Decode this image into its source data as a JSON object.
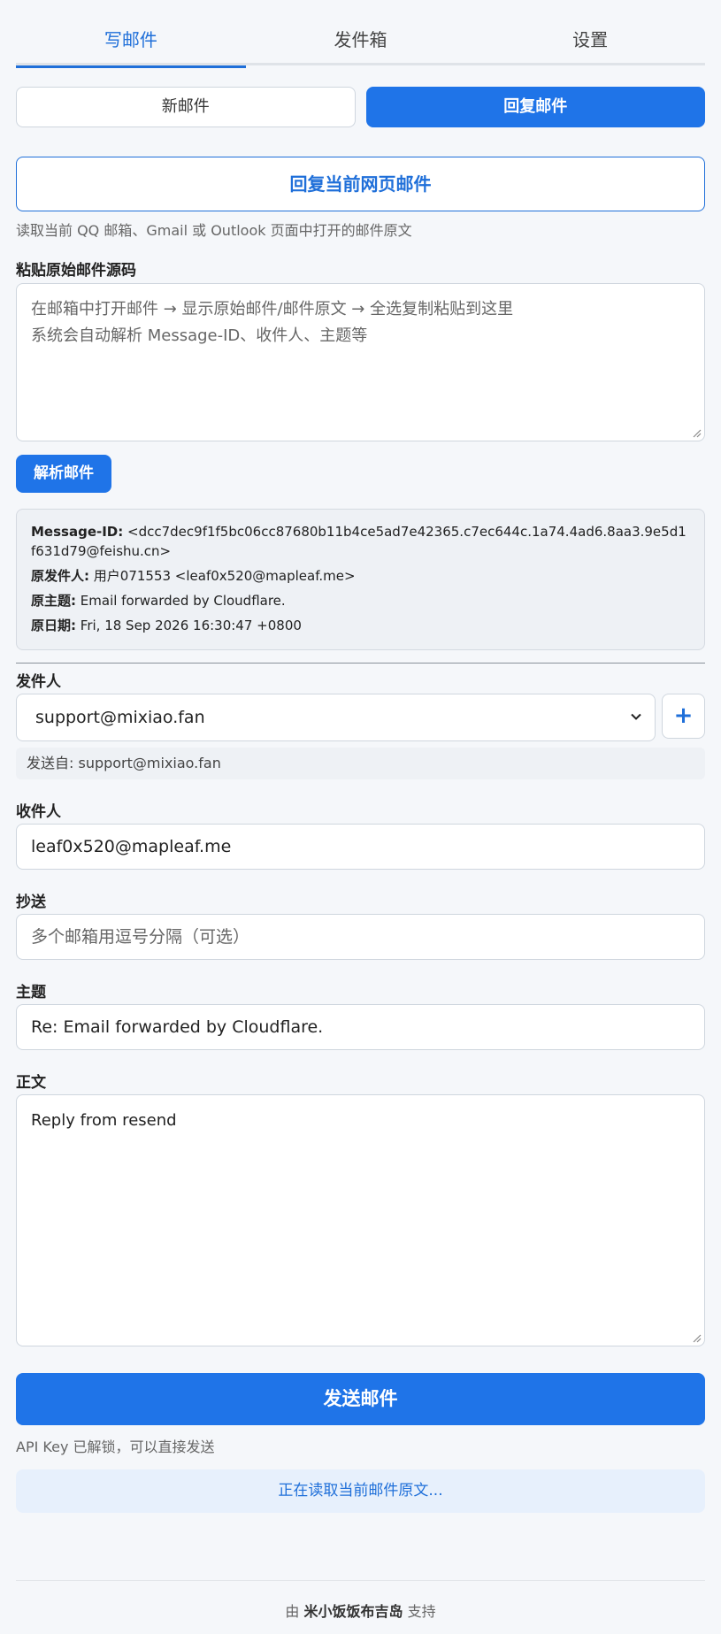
{
  "tabs": [
    {
      "label": "写邮件",
      "active": true
    },
    {
      "label": "发件箱",
      "active": false
    },
    {
      "label": "设置",
      "active": false
    }
  ],
  "mode": {
    "new_label": "新邮件",
    "reply_label": "回复邮件",
    "selected": "reply"
  },
  "reply_web": {
    "button_label": "回复当前网页邮件",
    "hint": "读取当前 QQ 邮箱、Gmail 或 Outlook 页面中打开的邮件原文"
  },
  "raw_source": {
    "label": "粘贴原始邮件源码",
    "placeholder_line1": "在邮箱中打开邮件 → 显示原始邮件/邮件原文 → 全选复制粘贴到这里",
    "placeholder_line2": "系统会自动解析 Message-ID、收件人、主题等",
    "parse_button": "解析邮件"
  },
  "parsed": {
    "message_id_key": "Message-ID:",
    "message_id": "<dcc7dec9f1f5bc06cc87680b11b4ce5ad7e42365.c7ec644c.1a74.4ad6.8aa3.9e5d1f631d79@feishu.cn>",
    "from_key": "原发件人:",
    "from": "用户071553 <leaf0x520@mapleaf.me>",
    "subject_key": "原主题:",
    "subject": "Email forwarded by Cloudflare.",
    "date_key": "原日期:",
    "date": "Fri, 18 Sep 2026 16:30:47 +0800"
  },
  "sender": {
    "label": "发件人",
    "selected": "support@mixiao.fan",
    "add_button": "+",
    "sent_from": "发送自: support@mixiao.fan"
  },
  "to": {
    "label": "收件人",
    "value": "leaf0x520@mapleaf.me"
  },
  "cc": {
    "label": "抄送",
    "placeholder": "多个邮箱用逗号分隔（可选）"
  },
  "subject": {
    "label": "主题",
    "value": "Re: Email forwarded by Cloudflare."
  },
  "body": {
    "label": "正文",
    "value": "Reply from resend"
  },
  "send": {
    "button_label": "发送邮件",
    "api_hint": "API Key 已解锁，可以直接发送",
    "status": "正在读取当前邮件原文..."
  },
  "footer": {
    "prefix": "由",
    "brand": "米小饭饭布吉岛",
    "suffix": "支持"
  },
  "colors": {
    "accent": "#1f74e8",
    "link": "#1f6fd9",
    "background": "#f5f7fa"
  }
}
